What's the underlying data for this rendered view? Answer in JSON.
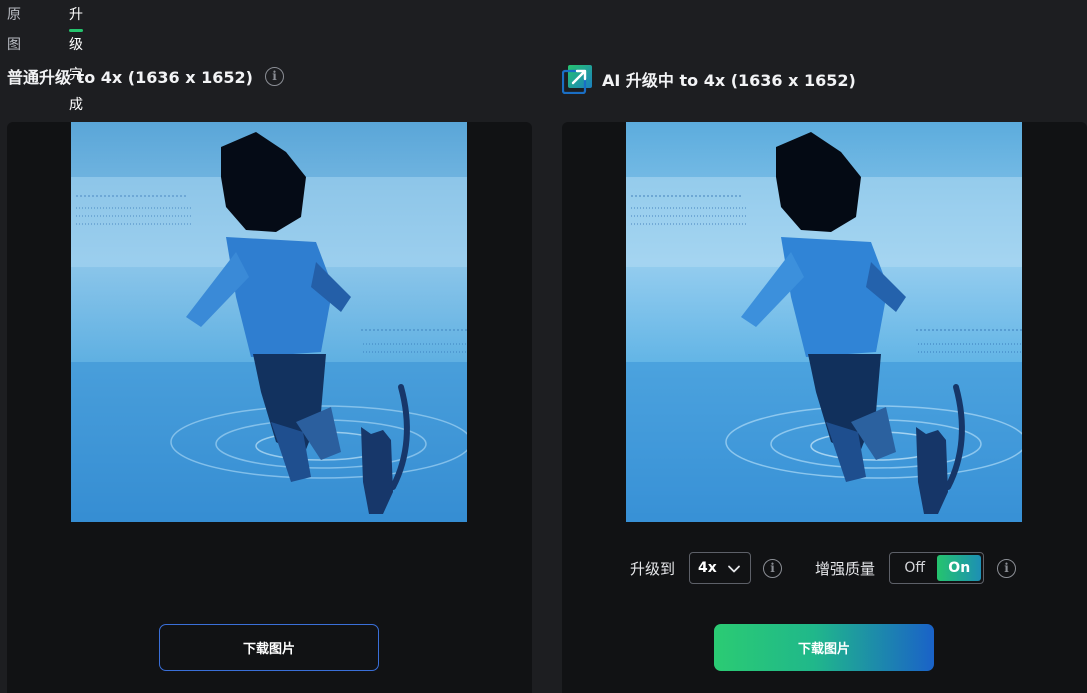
{
  "tabs": {
    "original": "原图",
    "upscaled": "升级完成"
  },
  "left": {
    "title": "普通升级 to 4x (1636 x 1652)",
    "download": "下载图片"
  },
  "right": {
    "title": "AI 升级中 to 4x (1636 x 1652)",
    "scale_label": "升级到",
    "scale_value": "4x",
    "quality_label": "增强质量",
    "toggle_off": "Off",
    "toggle_on": "On",
    "download": "下载图片"
  },
  "colors": {
    "accent_green": "#25c46e",
    "accent_blue": "#1a62c8",
    "panel_bg": "#111214",
    "page_bg": "#1d1e21"
  },
  "icons": [
    "info-icon",
    "ai-upscale-icon",
    "chevron-down-icon"
  ]
}
